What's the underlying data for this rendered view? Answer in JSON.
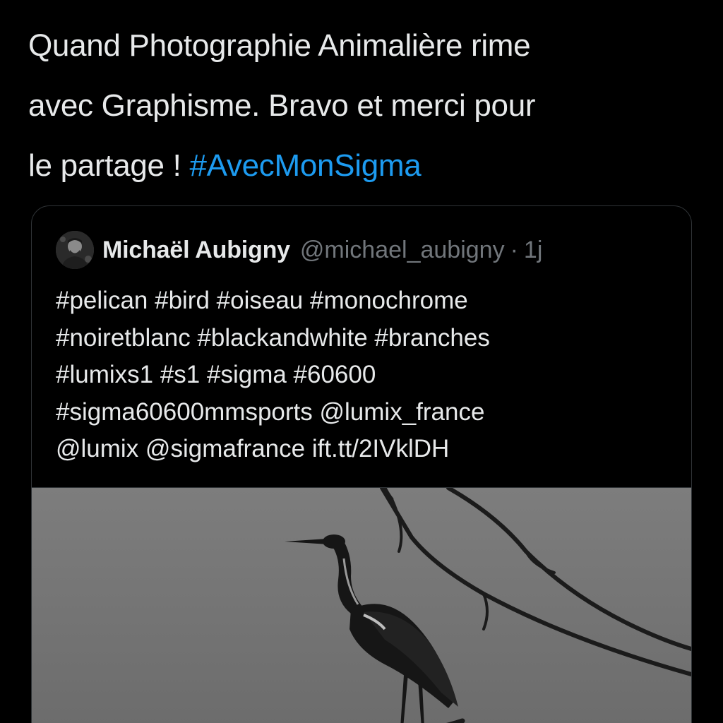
{
  "tweet": {
    "text": "Quand Photographie Animalière rime\navec Graphisme. Bravo et merci pour\nle partage ! ",
    "hashtag": "#AvecMonSigma"
  },
  "quoted_tweet": {
    "author_name": "Michaël Aubigny",
    "author_handle": "@michael_aubigny",
    "separator": "·",
    "time": "1j",
    "text": "#pelican #bird #oiseau #monochrome\n#noiretblanc #blackandwhite #branches\n#lumixs1 #s1 #sigma #60600\n#sigma60600mmsports @lumix_france\n@lumix @sigmafrance ift.tt/2IVklDH"
  },
  "colors": {
    "background": "#000000",
    "text": "#e7e9ea",
    "link": "#1d9bf0",
    "muted": "#71767b",
    "border": "#2f3336",
    "photo_sky": "#7a7a7a"
  },
  "icons": {
    "avatar": "avatar-photo",
    "photo": "heron-on-branch-photo"
  }
}
